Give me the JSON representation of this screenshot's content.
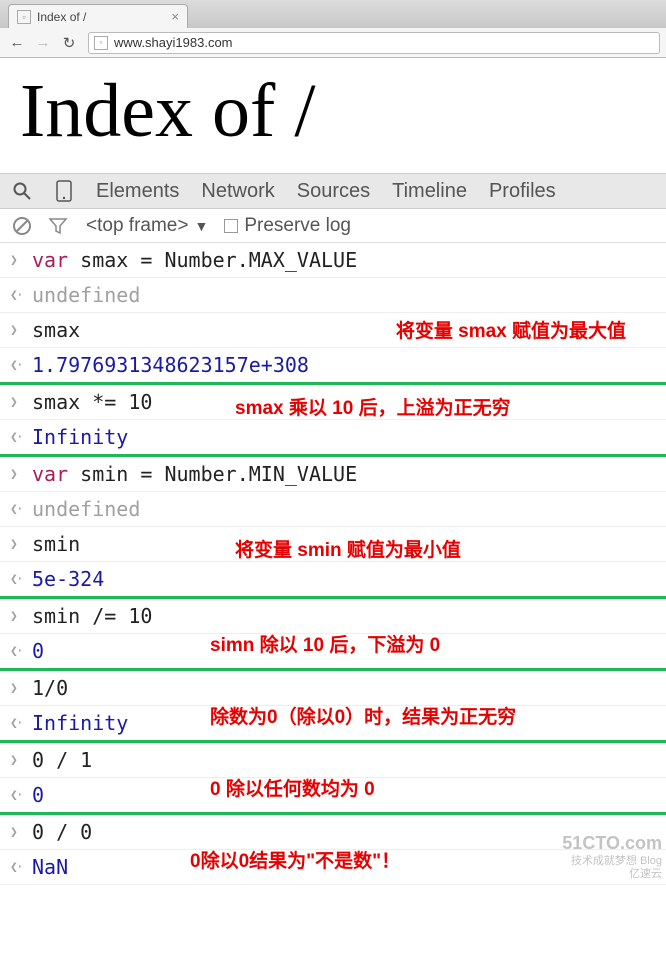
{
  "browser": {
    "tab_title": "Index of /",
    "url": "www.shayi1983.com"
  },
  "page": {
    "heading": "Index of /"
  },
  "devtools": {
    "tabs": [
      "Elements",
      "Network",
      "Sources",
      "Timeline",
      "Profiles"
    ],
    "frame_selector": "<top frame>",
    "preserve_log_label": "Preserve log"
  },
  "console_lines": [
    {
      "dir": "in",
      "type": "mixed",
      "parts": [
        [
          "kw",
          "var"
        ],
        [
          "plain",
          " smax = Number.MAX_VALUE"
        ]
      ],
      "sep": false
    },
    {
      "dir": "out",
      "type": "gray",
      "text": "undefined",
      "sep": false,
      "annot": "将变量 smax 赋值为最大值",
      "annot_pos": "right:40px;top:38px;"
    },
    {
      "dir": "in",
      "type": "plain",
      "text": "smax",
      "sep": false
    },
    {
      "dir": "out",
      "type": "blue",
      "text": "1.7976931348623157e+308",
      "sep": true
    },
    {
      "dir": "in",
      "type": "plain",
      "text": "smax *= 10",
      "sep": false,
      "annot": "smax 乘以 10 后，上溢为正无穷",
      "annot_pos": "left:235px;top:8px;"
    },
    {
      "dir": "out",
      "type": "blue",
      "text": "Infinity",
      "sep": true
    },
    {
      "dir": "in",
      "type": "mixed",
      "parts": [
        [
          "kw",
          "var"
        ],
        [
          "plain",
          " smin = Number.MIN_VALUE"
        ]
      ],
      "sep": false
    },
    {
      "dir": "out",
      "type": "gray",
      "text": "undefined",
      "sep": false
    },
    {
      "dir": "in",
      "type": "plain",
      "text": "smin",
      "sep": false,
      "annot": "将变量 smin 赋值为最小值",
      "annot_pos": "left:235px;top:8px;"
    },
    {
      "dir": "out",
      "type": "blue",
      "text": "5e-324",
      "sep": true
    },
    {
      "dir": "in",
      "type": "plain",
      "text": "smin /= 10",
      "sep": false
    },
    {
      "dir": "out",
      "type": "blue",
      "text": "0",
      "sep": true,
      "annot": "simn 除以 10 后，下溢为 0",
      "annot_pos": "left:210px;top:-4px;"
    },
    {
      "dir": "in",
      "type": "plain",
      "text": "1/0",
      "sep": false
    },
    {
      "dir": "out",
      "type": "blue",
      "text": "Infinity",
      "sep": true,
      "annot": "除数为0（除以0）时，结果为正无穷",
      "annot_pos": "left:210px;top:-4px;"
    },
    {
      "dir": "in",
      "type": "plain",
      "text": "0 / 1",
      "sep": false
    },
    {
      "dir": "out",
      "type": "blue",
      "text": "0",
      "sep": true,
      "annot": "0 除以任何数均为 0",
      "annot_pos": "left:210px;top:-4px;"
    },
    {
      "dir": "in",
      "type": "plain",
      "text": "0 / 0",
      "sep": false
    },
    {
      "dir": "out",
      "type": "blue",
      "text": "NaN",
      "sep": false,
      "annot": "0除以0结果为\"不是数\"！",
      "annot_pos": "left:190px;top:-4px;"
    }
  ],
  "watermark": {
    "site": "51CTO.com",
    "sub1": "技术成就梦想 Blog",
    "sub2": "亿速云"
  }
}
